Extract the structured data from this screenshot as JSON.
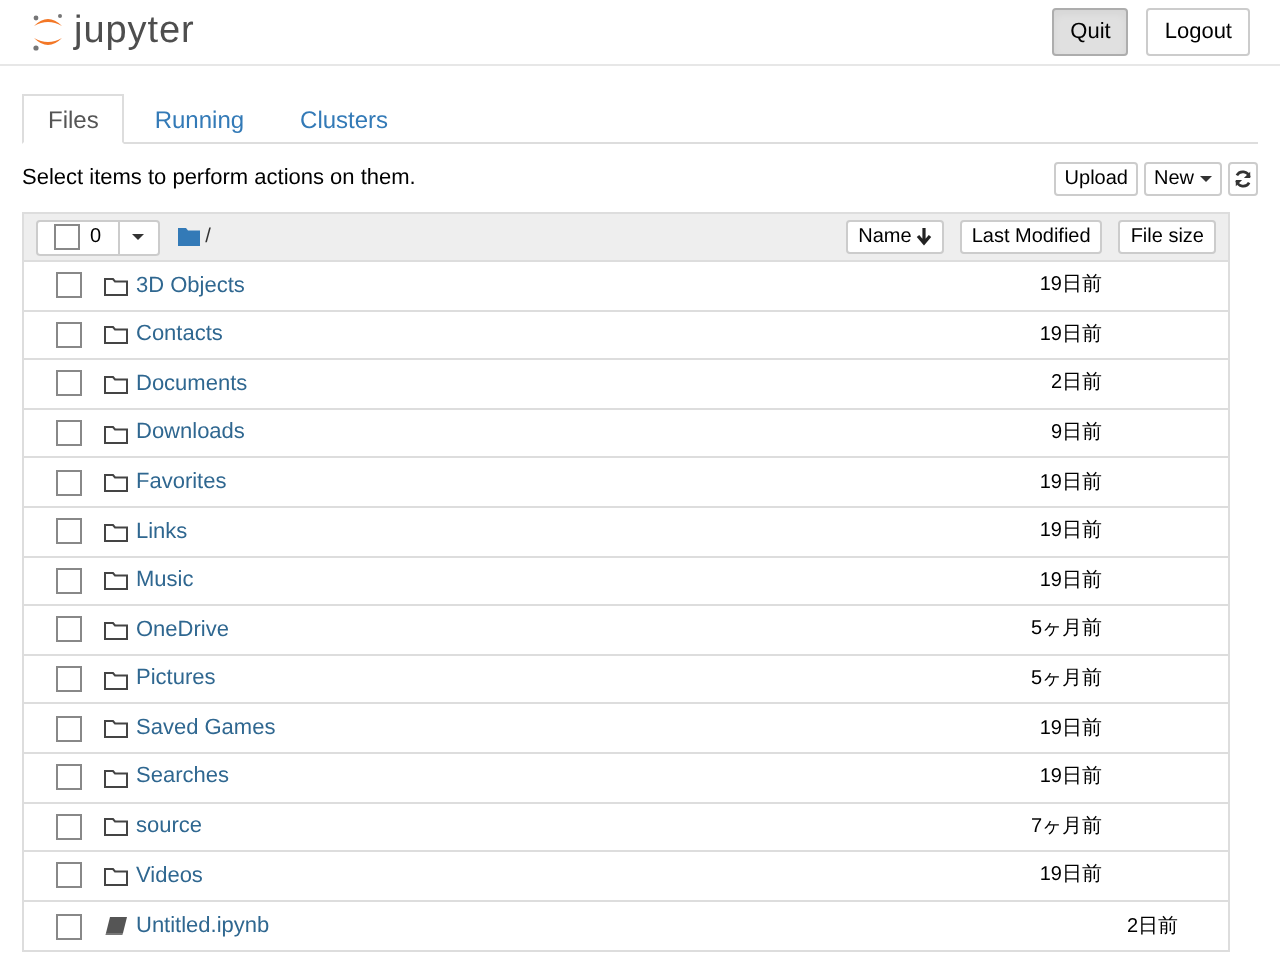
{
  "header": {
    "logo_text": "jupyter",
    "buttons": [
      {
        "label": "Quit",
        "pressed": true
      },
      {
        "label": "Logout",
        "pressed": false
      }
    ]
  },
  "tabs": [
    {
      "label": "Files",
      "selected": true
    },
    {
      "label": "Running",
      "selected": false
    },
    {
      "label": "Clusters",
      "selected": false
    }
  ],
  "toolbar": {
    "hint": "Select items to perform actions on them.",
    "buttons": [
      "Upload",
      "New"
    ]
  },
  "list_header": {
    "select_all_checked": false,
    "selected_count": "0",
    "path": "/",
    "sort_buttons": [
      "Name",
      "Last Modified",
      "File size"
    ]
  },
  "items": [
    {
      "kind": "folder",
      "name": "3D Objects",
      "modified": "19日前",
      "checked": false
    },
    {
      "kind": "folder",
      "name": "Contacts",
      "modified": "19日前",
      "checked": false
    },
    {
      "kind": "folder",
      "name": "Documents",
      "modified": "2日前",
      "checked": false
    },
    {
      "kind": "folder",
      "name": "Downloads",
      "modified": "9日前",
      "checked": false
    },
    {
      "kind": "folder",
      "name": "Favorites",
      "modified": "19日前",
      "checked": false
    },
    {
      "kind": "folder",
      "name": "Links",
      "modified": "19日前",
      "checked": false
    },
    {
      "kind": "folder",
      "name": "Music",
      "modified": "19日前",
      "checked": false
    },
    {
      "kind": "folder",
      "name": "OneDrive",
      "modified": "5ヶ月前",
      "checked": false
    },
    {
      "kind": "folder",
      "name": "Pictures",
      "modified": "5ヶ月前",
      "checked": false
    },
    {
      "kind": "folder",
      "name": "Saved Games",
      "modified": "19日前",
      "checked": false
    },
    {
      "kind": "folder",
      "name": "Searches",
      "modified": "19日前",
      "checked": false
    },
    {
      "kind": "folder",
      "name": "source",
      "modified": "7ヶ月前",
      "checked": false
    },
    {
      "kind": "folder",
      "name": "Videos",
      "modified": "19日前",
      "checked": false
    },
    {
      "kind": "notebook",
      "name": "Untitled.ipynb",
      "modified": "2日前",
      "checked": false
    }
  ]
}
